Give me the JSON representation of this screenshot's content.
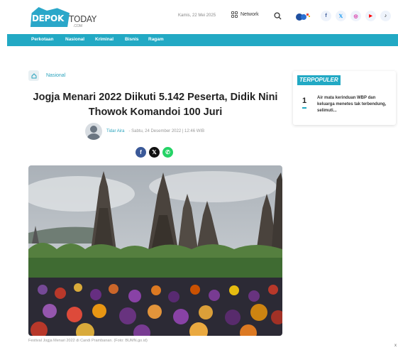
{
  "header": {
    "logo_depok": "DEPOK",
    "logo_today": "TODAY",
    "logo_com": ".COM",
    "date": "Kamis, 22 Mei 2025",
    "network_label": "Network"
  },
  "socials": [
    {
      "icon": "facebook-icon",
      "glyph": "f",
      "color": "#3b5998"
    },
    {
      "icon": "x-icon",
      "glyph": "𝕏",
      "color": "#1d9bf0"
    },
    {
      "icon": "instagram-icon",
      "glyph": "◎",
      "color": "#d6249f"
    },
    {
      "icon": "youtube-icon",
      "glyph": "▶",
      "color": "#ff0000"
    },
    {
      "icon": "tiktok-icon",
      "glyph": "♪",
      "color": "#222222"
    }
  ],
  "nav": [
    "Perkotaan",
    "Nasional",
    "Kriminal",
    "Bisnis",
    "Ragam"
  ],
  "breadcrumb": {
    "label": "Nasional"
  },
  "article": {
    "title": "Jogja Menari 2022 Diikuti 5.142 Peserta, Didik Nini Thowok Komandoi 100 Juri",
    "author": "Tidar Aira",
    "date": " - Sabtu, 24 Desember 2022 | 12:46 WIB",
    "caption": "Festival Jogja Menari 2022 di Candi Prambanan. (Foto: BUMN.go.id)"
  },
  "share": [
    {
      "icon": "facebook-share-icon",
      "glyph": "f",
      "color": "#3b5998"
    },
    {
      "icon": "x-share-icon",
      "glyph": "𝕏",
      "color": "#111111"
    },
    {
      "icon": "whatsapp-share-icon",
      "glyph": "✆",
      "color": "#25d366"
    }
  ],
  "sidebar": {
    "heading": "TERPOPULER",
    "items": [
      {
        "rank": "1",
        "text": "Air mata kerinduan WBP dan keluarga menetes tak terbendung, selimuti..."
      }
    ]
  },
  "colors": {
    "accent": "#22a9c4"
  }
}
